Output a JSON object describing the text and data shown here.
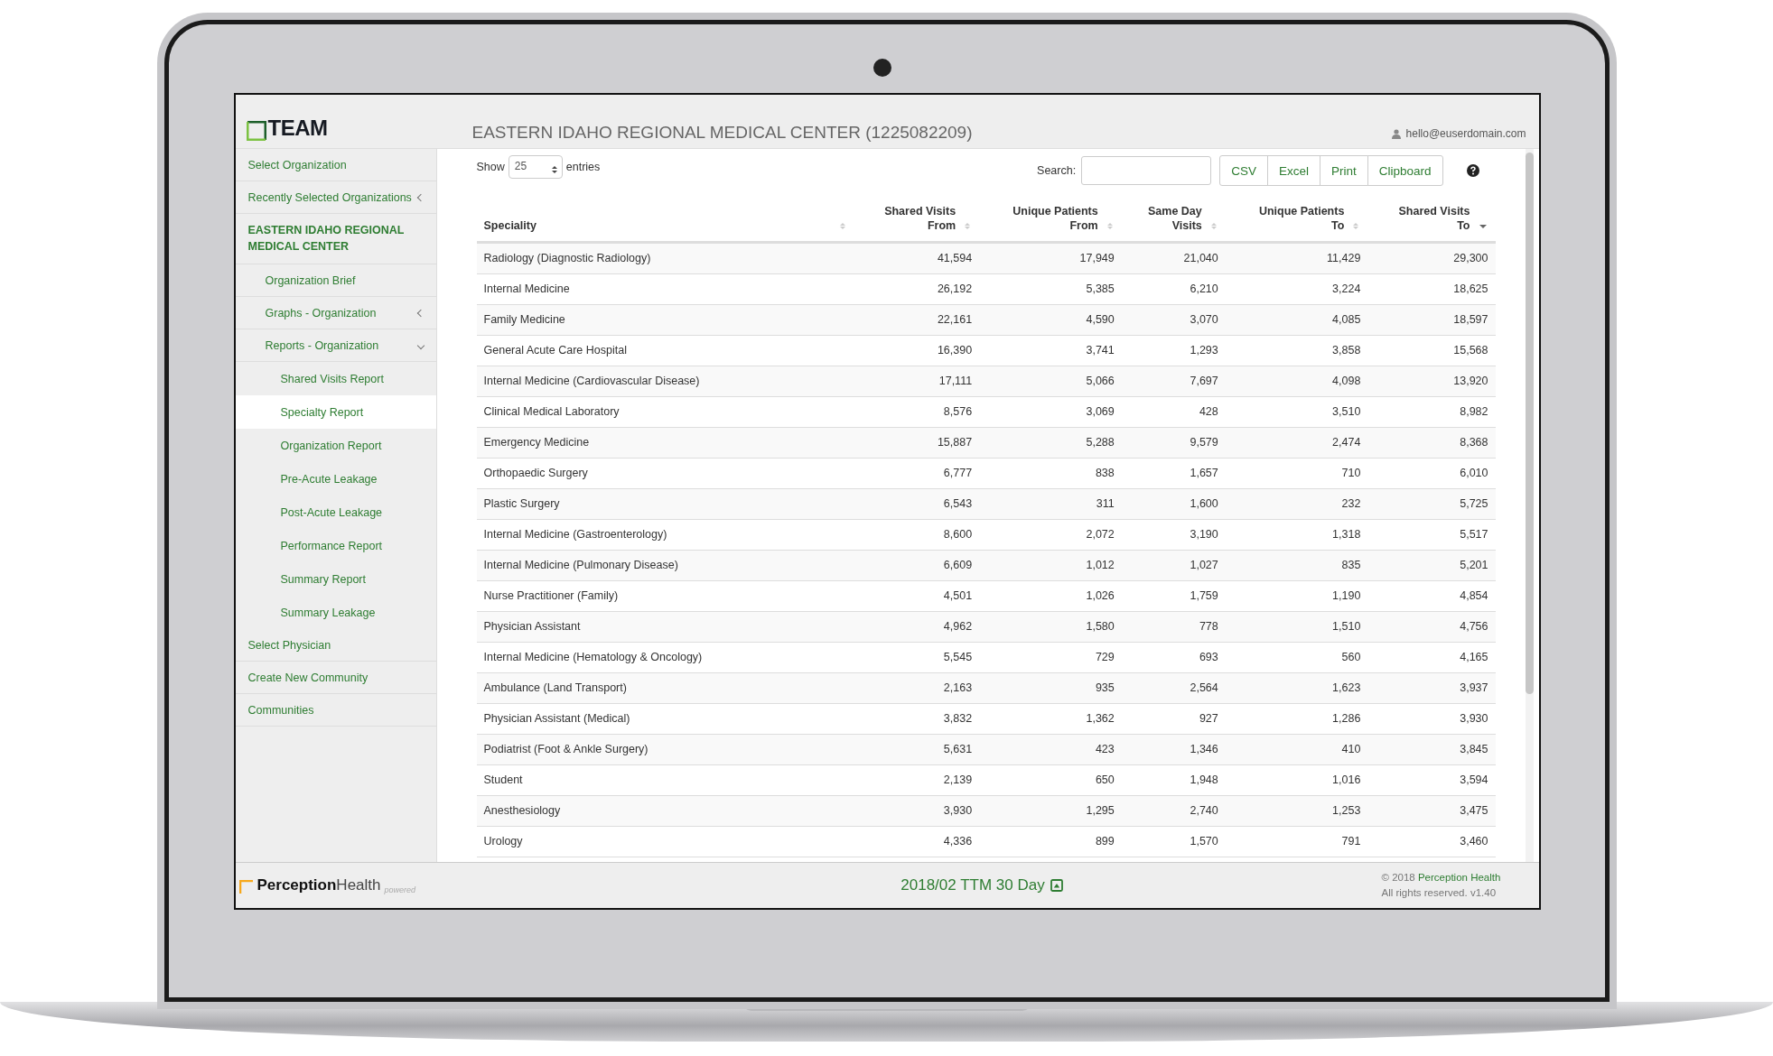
{
  "header": {
    "logo": "TEAM",
    "title": "EASTERN IDAHO REGIONAL MEDICAL CENTER (1225082209)",
    "user": "hello@euserdomain.com"
  },
  "sidebar": {
    "items": [
      {
        "label": "Select Organization",
        "kind": "link",
        "selected": false
      },
      {
        "label": "Recently Selected Organizations",
        "kind": "link",
        "selected": false,
        "expanded": false
      },
      {
        "label": "EASTERN IDAHO REGIONAL MEDICAL CENTER",
        "kind": "organization",
        "selected": false,
        "children": [
          {
            "label": "Organization Brief",
            "selected": false
          },
          {
            "label": "Graphs - Organization",
            "selected": false,
            "expanded": false
          },
          {
            "label": "Reports - Organization",
            "selected": false,
            "expanded": true,
            "children": [
              {
                "label": "Shared Visits Report",
                "selected": false
              },
              {
                "label": "Specialty Report",
                "selected": true
              },
              {
                "label": "Organization Report",
                "selected": false
              },
              {
                "label": "Pre-Acute Leakage",
                "selected": false
              },
              {
                "label": "Post-Acute Leakage",
                "selected": false
              },
              {
                "label": "Performance Report",
                "selected": false
              },
              {
                "label": "Summary Report",
                "selected": false
              },
              {
                "label": "Summary Leakage",
                "selected": false
              }
            ]
          }
        ]
      },
      {
        "label": "Select Physician",
        "kind": "link",
        "selected": false
      },
      {
        "label": "Create New Community",
        "kind": "link",
        "selected": false
      },
      {
        "label": "Communities",
        "kind": "link",
        "selected": false
      }
    ]
  },
  "toolbar": {
    "show_label": "Show",
    "page_size": "25",
    "entries_label": "entries",
    "search_label": "Search:",
    "buttons": [
      "CSV",
      "Excel",
      "Print",
      "Clipboard"
    ]
  },
  "table": {
    "columns": [
      {
        "label": "Speciality",
        "sorted": false
      },
      {
        "label": "Shared Visits\nFrom",
        "sorted": false
      },
      {
        "label": "Unique Patients\nFrom",
        "sorted": false
      },
      {
        "label": "Same Day\nVisits",
        "sorted": false
      },
      {
        "label": "Unique Patients\nTo",
        "sorted": false
      },
      {
        "label": "Shared Visits\nTo",
        "sorted": true
      }
    ],
    "rows": [
      [
        "Radiology (Diagnostic Radiology)",
        "41,594",
        "17,949",
        "21,040",
        "11,429",
        "29,300"
      ],
      [
        "Internal Medicine",
        "26,192",
        "5,385",
        "6,210",
        "3,224",
        "18,625"
      ],
      [
        "Family Medicine",
        "22,161",
        "4,590",
        "3,070",
        "4,085",
        "18,597"
      ],
      [
        "General Acute Care Hospital",
        "16,390",
        "3,741",
        "1,293",
        "3,858",
        "15,568"
      ],
      [
        "Internal Medicine (Cardiovascular Disease)",
        "17,111",
        "5,066",
        "7,697",
        "4,098",
        "13,920"
      ],
      [
        "Clinical Medical Laboratory",
        "8,576",
        "3,069",
        "428",
        "3,510",
        "8,982"
      ],
      [
        "Emergency Medicine",
        "15,887",
        "5,288",
        "9,579",
        "2,474",
        "8,368"
      ],
      [
        "Orthopaedic Surgery",
        "6,777",
        "838",
        "1,657",
        "710",
        "6,010"
      ],
      [
        "Plastic Surgery",
        "6,543",
        "311",
        "1,600",
        "232",
        "5,725"
      ],
      [
        "Internal Medicine (Gastroenterology)",
        "8,600",
        "2,072",
        "3,190",
        "1,318",
        "5,517"
      ],
      [
        "Internal Medicine (Pulmonary Disease)",
        "6,609",
        "1,012",
        "1,027",
        "835",
        "5,201"
      ],
      [
        "Nurse Practitioner (Family)",
        "4,501",
        "1,026",
        "1,759",
        "1,190",
        "4,854"
      ],
      [
        "Physician Assistant",
        "4,962",
        "1,580",
        "778",
        "1,510",
        "4,756"
      ],
      [
        "Internal Medicine (Hematology & Oncology)",
        "5,545",
        "729",
        "693",
        "560",
        "4,165"
      ],
      [
        "Ambulance (Land Transport)",
        "2,163",
        "935",
        "2,564",
        "1,623",
        "3,937"
      ],
      [
        "Physician Assistant (Medical)",
        "3,832",
        "1,362",
        "927",
        "1,286",
        "3,930"
      ],
      [
        "Podiatrist (Foot & Ankle Surgery)",
        "5,631",
        "423",
        "1,346",
        "410",
        "3,845"
      ],
      [
        "Student",
        "2,139",
        "650",
        "1,948",
        "1,016",
        "3,594"
      ],
      [
        "Anesthesiology",
        "3,930",
        "1,295",
        "2,740",
        "1,253",
        "3,475"
      ],
      [
        "Urology",
        "4,336",
        "899",
        "1,570",
        "791",
        "3,460"
      ]
    ]
  },
  "footer": {
    "brand_bold": "Perception",
    "brand_light": "Health",
    "brand_tag": "powered",
    "period": "2018/02 TTM 30 Day",
    "copyright_prefix": "© 2018",
    "copyright_link": "Perception Health",
    "rights": "All rights reserved. v1.40"
  }
}
